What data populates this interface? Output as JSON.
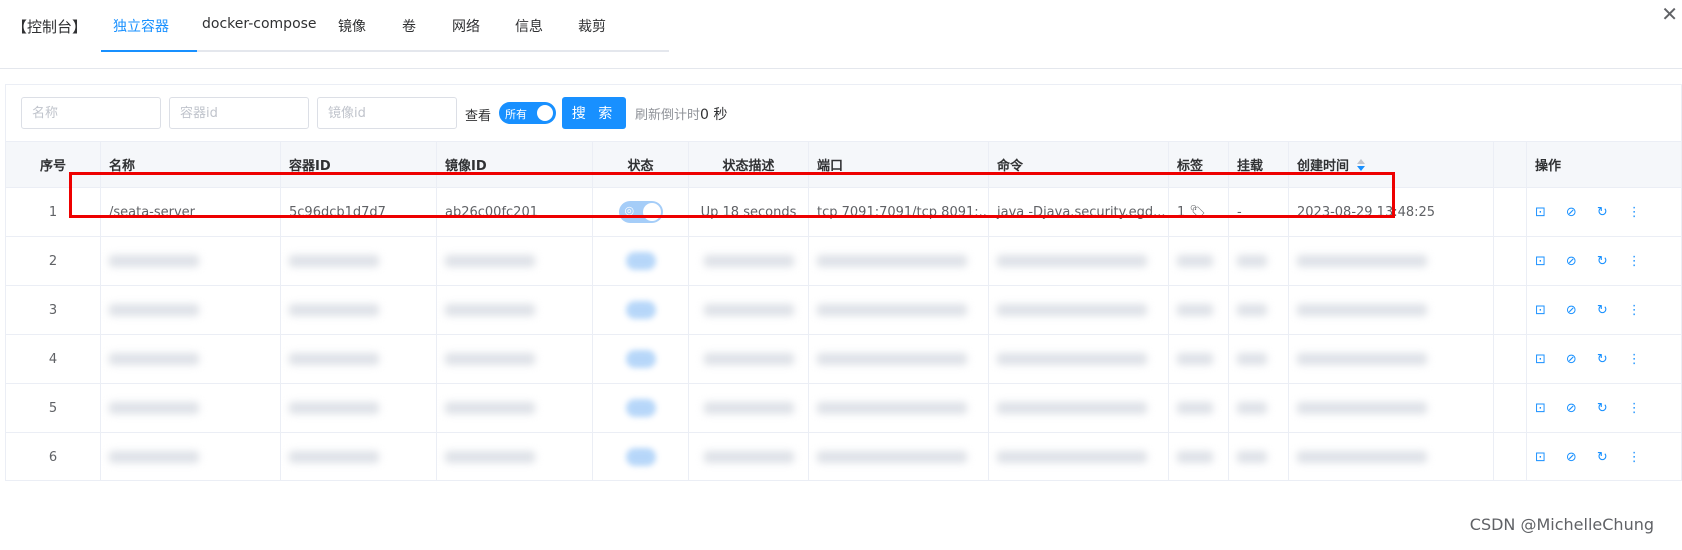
{
  "brand": "【控制台】",
  "tabs": [
    {
      "label": "独立容器",
      "active": true
    },
    {
      "label": "docker-compose"
    },
    {
      "label": "镜像"
    },
    {
      "label": "卷"
    },
    {
      "label": "网络"
    },
    {
      "label": "信息"
    },
    {
      "label": "裁剪"
    }
  ],
  "close_icon": "close-icon",
  "search": {
    "name_placeholder": "名称",
    "container_id_placeholder": "容器id",
    "image_id_placeholder": "镜像id",
    "view_label": "查看",
    "view_switch_label": "所有",
    "search_button": "搜 索",
    "refresh_label": "刷新倒计时",
    "refresh_count": "0 秒"
  },
  "table": {
    "headers": {
      "index": "序号",
      "name": "名称",
      "container_id": "容器ID",
      "image_id": "镜像ID",
      "status": "状态",
      "status_desc": "状态描述",
      "port": "端口",
      "command": "命令",
      "tags": "标签",
      "mount": "挂载",
      "created": "创建时间",
      "ops": "操作"
    },
    "rows": [
      {
        "index": "1",
        "name": "/seata-server",
        "container_id": "5c96dcb1d7d7",
        "image_id": "ab26c00fc201",
        "status_on": true,
        "status_desc": "Up 18 seconds",
        "port": "tcp 7091:7091/tcp 8091:...",
        "command": "java -Djava.security.egd...",
        "tags": "1",
        "mount": "-",
        "created": "2023-08-29 13:48:25"
      },
      {
        "index": "2",
        "blurred": true
      },
      {
        "index": "3",
        "blurred": true
      },
      {
        "index": "4",
        "blurred": true
      },
      {
        "index": "5",
        "blurred": true
      },
      {
        "index": "6",
        "blurred": true
      }
    ],
    "op_icons": [
      "terminal-icon",
      "stop-icon",
      "restart-icon",
      "more-icon"
    ],
    "op_glyphs": [
      "⊡",
      "⊘",
      "↻",
      "⋮"
    ]
  },
  "watermark": "CSDN @MichelleChung",
  "colors": {
    "accent": "#1890ff",
    "highlight": "#e00000"
  }
}
